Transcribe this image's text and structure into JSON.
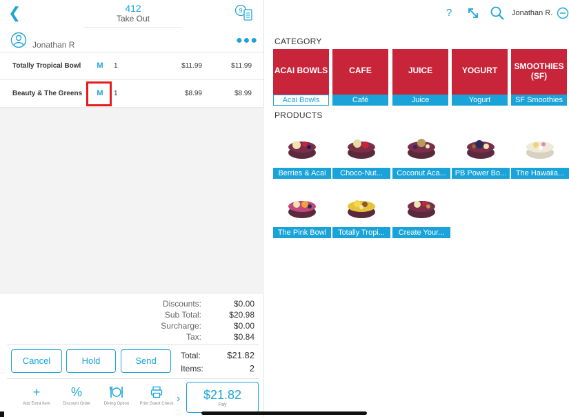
{
  "order": {
    "number": "412",
    "type": "Take Out",
    "guest_count": "9"
  },
  "customer": {
    "name": "Jonathan R"
  },
  "items": [
    {
      "name": "Totally Tropical Bowl",
      "modifier": "M",
      "qty": "1",
      "price": "$11.99",
      "total": "$11.99"
    },
    {
      "name": "Beauty & The Greens",
      "modifier": "M",
      "qty": "1",
      "price": "$8.99",
      "total": "$8.99"
    }
  ],
  "summary": {
    "discounts_label": "Discounts:",
    "discounts": "$0.00",
    "subtotal_label": "Sub Total:",
    "subtotal": "$20.98",
    "surcharge_label": "Surcharge:",
    "surcharge": "$0.00",
    "tax_label": "Tax:",
    "tax": "$0.84",
    "total_label": "Total:",
    "total": "$21.82",
    "items_label": "Items:",
    "items": "2"
  },
  "buttons": {
    "cancel": "Cancel",
    "hold": "Hold",
    "send": "Send"
  },
  "actions": [
    {
      "icon": "plus-icon",
      "label": "Add Extra Item"
    },
    {
      "icon": "percent-icon",
      "label": "Discount Order"
    },
    {
      "icon": "dining-icon",
      "label": "Dining Option"
    },
    {
      "icon": "printer-icon",
      "label": "Print Guest Check"
    }
  ],
  "pay": {
    "amount": "$21.82",
    "label": "Pay"
  },
  "topbar": {
    "help": "?",
    "user": "Jonathan R."
  },
  "category_title": "CATEGORY",
  "categories": [
    {
      "name": "ACAI BOWLS",
      "sub": "Acai Bowls",
      "selected": true
    },
    {
      "name": "CAFE",
      "sub": "Café"
    },
    {
      "name": "JUICE",
      "sub": "Juice"
    },
    {
      "name": "YOGURT",
      "sub": "Yogurt"
    },
    {
      "name": "SMOOTHIES (SF)",
      "sub": "SF Smoothies"
    }
  ],
  "products_title": "PRODUCTS",
  "products": [
    {
      "label": "Berries & Acai"
    },
    {
      "label": "Choco-Nut..."
    },
    {
      "label": "Coconut Aca..."
    },
    {
      "label": "PB Power Bo..."
    },
    {
      "label": "The Hawaiia..."
    },
    {
      "label": "The Pink Bowl"
    },
    {
      "label": "Totally Tropi..."
    },
    {
      "label": "Create Your..."
    }
  ],
  "colors": {
    "accent": "#1aa3d9",
    "category_red": "#c9253a",
    "highlight": "#e21b1b"
  }
}
